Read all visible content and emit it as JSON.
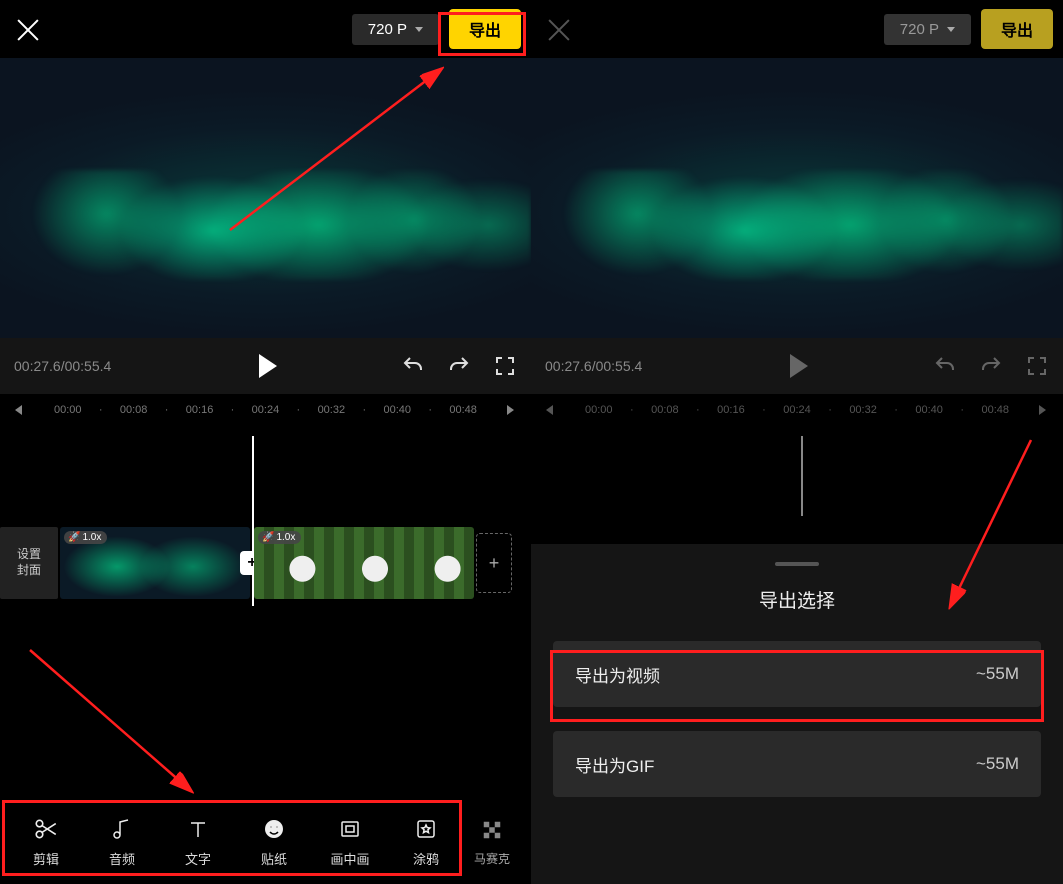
{
  "left": {
    "topbar": {
      "resolution": "720 P",
      "export_label": "导出"
    },
    "player": {
      "time": "00:27.6/00:55.4"
    },
    "ruler": {
      "marks": [
        "00:00",
        "00:08",
        "00:16",
        "00:24",
        "00:32",
        "00:40",
        "00:48"
      ]
    },
    "track": {
      "cover_line1": "设置",
      "cover_line2": "封面",
      "speed_a": "1.0x",
      "speed_b": "1.0x"
    },
    "tools": [
      {
        "name": "cut",
        "label": "剪辑"
      },
      {
        "name": "audio",
        "label": "音频"
      },
      {
        "name": "text",
        "label": "文字"
      },
      {
        "name": "sticker",
        "label": "贴纸"
      },
      {
        "name": "pip",
        "label": "画中画"
      },
      {
        "name": "doodle",
        "label": "涂鸦"
      }
    ],
    "extra_tool": {
      "label": "马赛克"
    }
  },
  "right": {
    "topbar": {
      "resolution": "720 P",
      "export_label": "导出"
    },
    "player": {
      "time": "00:27.6/00:55.4"
    },
    "ruler": {
      "marks": [
        "00:00",
        "00:08",
        "00:16",
        "00:24",
        "00:32",
        "00:40",
        "00:48"
      ]
    },
    "sheet": {
      "title": "导出选择",
      "items": [
        {
          "label": "导出为视频",
          "size": "~55M"
        },
        {
          "label": "导出为GIF",
          "size": "~55M"
        }
      ]
    }
  }
}
